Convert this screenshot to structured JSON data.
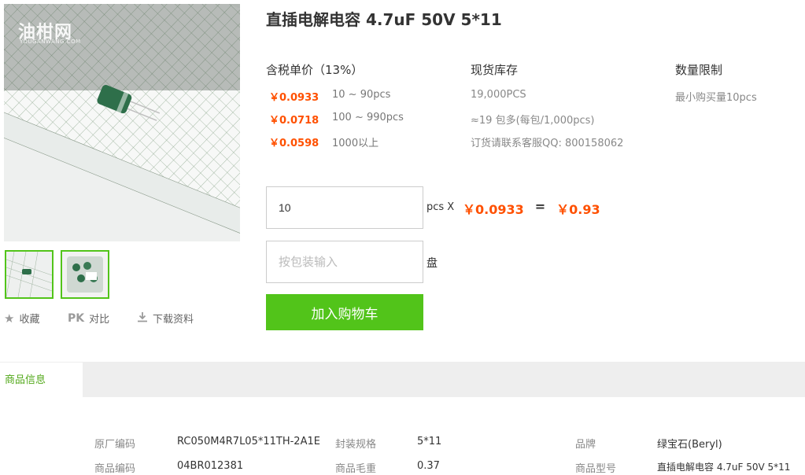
{
  "product": {
    "title": "直插电解电容 4.7uF 50V 5*11",
    "watermark": "油柑网",
    "watermark_sub": "YOUGANWANG.COM"
  },
  "pricing": {
    "header": "含税单价（13%）",
    "tiers": [
      {
        "price": "￥0.0933",
        "range": "10 ~ 90pcs"
      },
      {
        "price": "￥0.0718",
        "range": "100 ~ 990pcs"
      },
      {
        "price": "￥0.0598",
        "range": "1000以上"
      }
    ]
  },
  "stock": {
    "header": "现货库存",
    "quantity": "19,000PCS",
    "packages": "≈19 包多(每包/1,000pcs)",
    "order_contact": "订货请联系客服QQ: 800158062"
  },
  "limit": {
    "header": "数量限制",
    "min_purchase": "最小购买量10pcs"
  },
  "order": {
    "qty_value": "10",
    "qty_unit": "pcs X",
    "unit_price": "￥0.0933",
    "equals": "=",
    "total": "￥0.93",
    "pack_placeholder": "按包装输入",
    "pack_unit": "盘",
    "cart_label": "加入购物车"
  },
  "actions": {
    "favorite": "收藏",
    "pk_icon": "PK",
    "compare": "对比",
    "download": "下载资料"
  },
  "tabs": {
    "active": "商品信息"
  },
  "info": {
    "rows": [
      {
        "l1": "原厂编码",
        "v1": "RC050M4R7L05*11TH-2A1E",
        "l2": "封装规格",
        "v2": "5*11",
        "l3": "品牌",
        "v3": "绿宝石(Beryl)"
      },
      {
        "l1": "商品编码",
        "v1": "04BR012381",
        "l2": "商品毛重",
        "v2": "0.37",
        "l3": "商品型号",
        "v3": "直插电解电容 4.7uF 50V 5*11"
      }
    ]
  },
  "colors": {
    "accent_green": "#52c41a",
    "price_orange": "#ff5000"
  },
  "icons": {
    "favorite": "star-icon",
    "download": "download-icon"
  }
}
